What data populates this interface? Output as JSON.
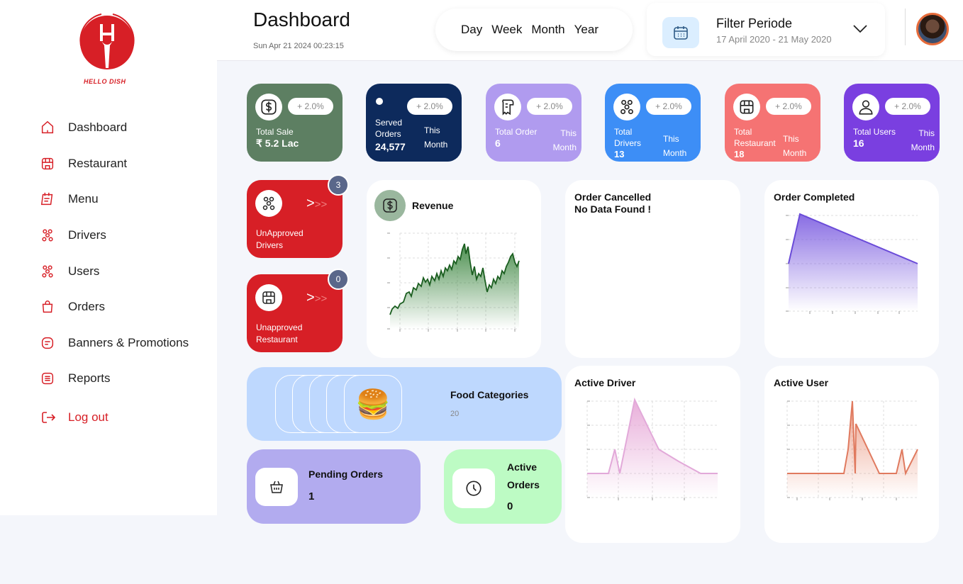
{
  "brand": {
    "name": "HELLO DISH",
    "color": "#d71f26"
  },
  "sidebar": {
    "items": [
      {
        "label": "Dashboard",
        "icon": "home-icon"
      },
      {
        "label": "Restaurant",
        "icon": "store-icon"
      },
      {
        "label": "Menu",
        "icon": "menu-book-icon"
      },
      {
        "label": "Drivers",
        "icon": "drivers-icon"
      },
      {
        "label": "Users",
        "icon": "users-icon"
      },
      {
        "label": "Orders",
        "icon": "shopping-bag-icon"
      },
      {
        "label": "Banners & Promotions",
        "icon": "banner-icon"
      },
      {
        "label": "Reports",
        "icon": "reports-icon"
      }
    ],
    "logout": "Log out"
  },
  "header": {
    "title": "Dashboard",
    "datetime": "Sun Apr 21 2024 00:23:15",
    "periods": [
      "Day",
      "Week",
      "Month",
      "Year"
    ],
    "filter": {
      "title": "Filter Periode",
      "range": "17 April 2020 - 21 May 2020"
    }
  },
  "stats": [
    {
      "label": "Total Sale",
      "value": "₹ 5.2 Lac",
      "pct": "+ 2.0%",
      "period": "",
      "color": "#5d7f62",
      "icon": "dollar-icon"
    },
    {
      "label": "Served Orders",
      "value": "24,577",
      "pct": "+ 2.0%",
      "period": "This Month",
      "color": "#0d2a5c",
      "icon": "dot-icon"
    },
    {
      "label": "Total Order",
      "value": "6",
      "pct": "+ 2.0%",
      "period": "This Month",
      "color": "#b09bef",
      "icon": "receipt-icon"
    },
    {
      "label": "Total Drivers",
      "value": "13",
      "pct": "+ 2.0%",
      "period": "This Month",
      "color": "#3d8ef6",
      "icon": "drivers-icon"
    },
    {
      "label": "Total Restaurant",
      "value": "18",
      "pct": "+ 2.0%",
      "period": "This Month",
      "color": "#f57373",
      "icon": "store-icon"
    },
    {
      "label": "Total Users",
      "value": "16",
      "pct": "+ 2.0%",
      "period": "This Month",
      "color": "#7a3fe0",
      "icon": "user-icon"
    }
  ],
  "alerts": [
    {
      "label": "UnApproved Drivers",
      "count": "3",
      "icon": "drivers-icon"
    },
    {
      "label": "Unapproved Restaurant",
      "count": "0",
      "icon": "store-icon"
    }
  ],
  "cards": {
    "revenue": "Revenue",
    "cancelled_title": "Order Cancelled",
    "cancelled_msg": "No Data Found !",
    "completed": "Order Completed",
    "active_driver": "Active Driver",
    "active_user": "Active User"
  },
  "food": {
    "title": "Food Categories",
    "count": "20"
  },
  "pending": {
    "label": "Pending Orders",
    "value": "1"
  },
  "active_orders": {
    "label1": "Active",
    "label2": "Orders",
    "value": "0"
  }
}
